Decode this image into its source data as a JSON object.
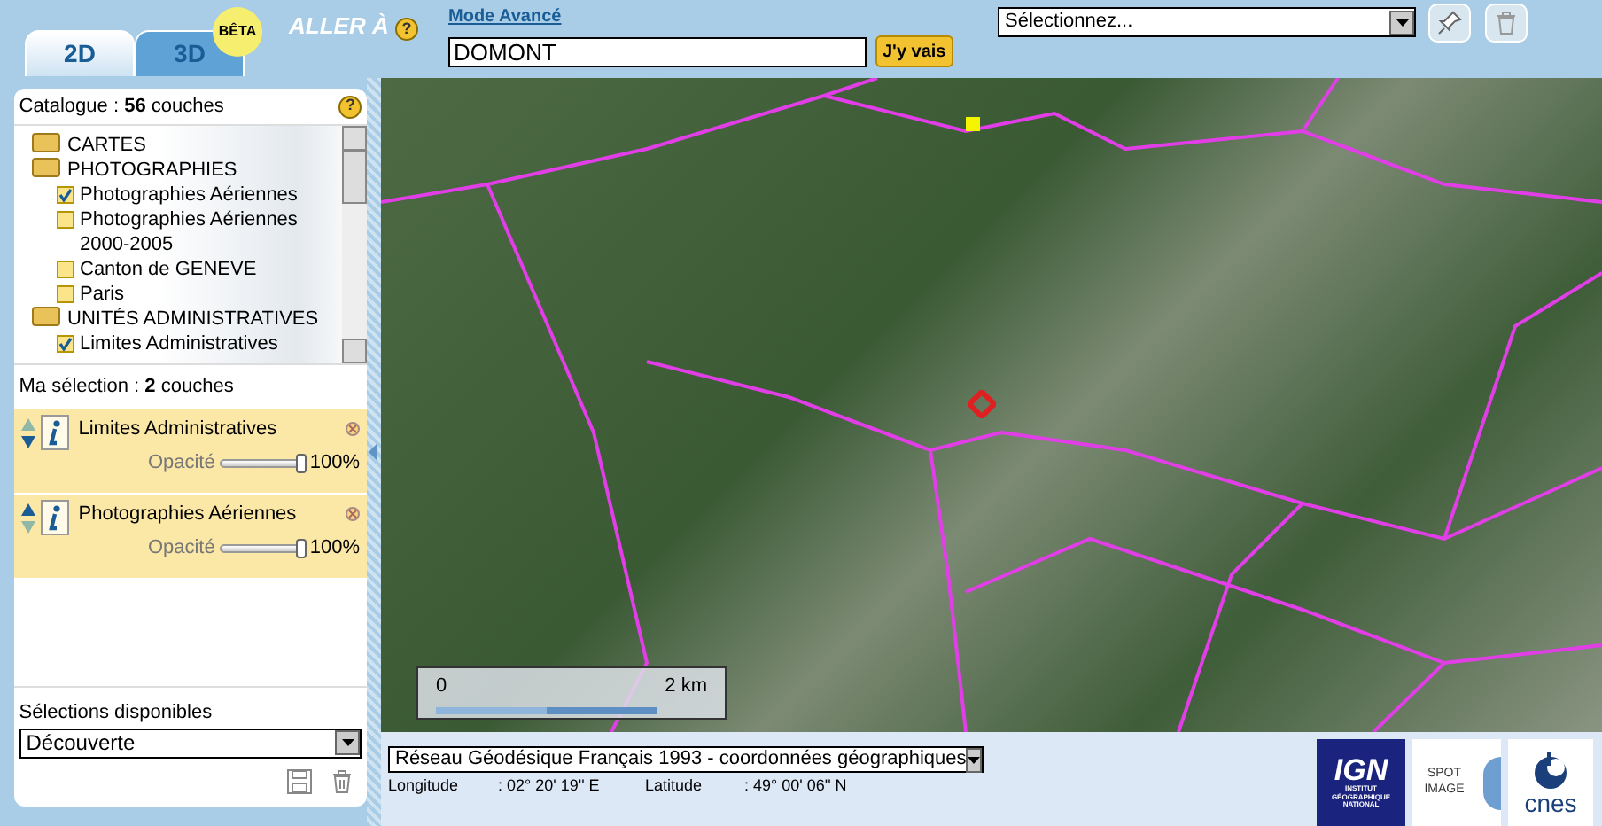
{
  "tabs": [
    {
      "label": "2D",
      "selected": true
    },
    {
      "label": "3D",
      "selected": false
    }
  ],
  "beta_badge": "BÊTA",
  "goto": {
    "label": "ALLER À",
    "help": "?"
  },
  "search": {
    "mode_link": "Mode Avancé",
    "value": "DOMONT",
    "button": "J'y vais"
  },
  "favorites": {
    "value": "Sélectionnez..."
  },
  "catalogue": {
    "title": "Catalogue : **56** couches",
    "help": "?",
    "tree": [
      {
        "label": "CARTES",
        "kind": "folder"
      },
      {
        "label": "PHOTOGRAPHIES",
        "kind": "folder",
        "children": [
          {
            "label": "Photographies Aériennes",
            "kind": "layer",
            "checked": true
          },
          {
            "label": "Photographies Aériennes 2000-2005",
            "kind": "layer",
            "checked": false
          },
          {
            "label": "Canton de GENEVE",
            "kind": "layer",
            "checked": false
          },
          {
            "label": "Paris",
            "kind": "layer",
            "checked": false
          }
        ]
      },
      {
        "label": "UNITÉS ADMINISTRATIVES",
        "kind": "folder",
        "children": [
          {
            "label": "Limites Administratives",
            "kind": "layer",
            "checked": true
          }
        ]
      }
    ]
  },
  "selection": {
    "title": "Ma sélection : **2** couches",
    "layers": [
      {
        "name": "Limites Administratives",
        "up_enabled": false,
        "down_enabled": true,
        "opacity_label": "Opacité",
        "level": 1,
        "reading": "100%"
      },
      {
        "name": "Photographies Aériennes",
        "up_enabled": true,
        "down_enabled": false,
        "opacity_label": "Opacité",
        "level": 1,
        "reading": "100%"
      }
    ]
  },
  "presets": {
    "label": "Sélections disponibles",
    "value": "Découverte"
  },
  "map": {
    "scale": {
      "start": "0",
      "end": "2 km"
    }
  },
  "status": {
    "projection": "Réseau Géodésique Français 1993 - coordonnées géographiques",
    "longitude_label": "Longitude",
    "longitude": ": 02° 20' 19'' E",
    "latitude_label": "Latitude",
    "latitude": ": 49° 00' 06'' N"
  },
  "logos": [
    {
      "kind": "ign",
      "text": "IGN",
      "subtitle": "INSTITUT GÉOGRAPHIQUE NATIONAL"
    },
    {
      "kind": "spot",
      "text": "SPOT IMAGE"
    },
    {
      "kind": "cnes",
      "text": "cnes"
    }
  ]
}
